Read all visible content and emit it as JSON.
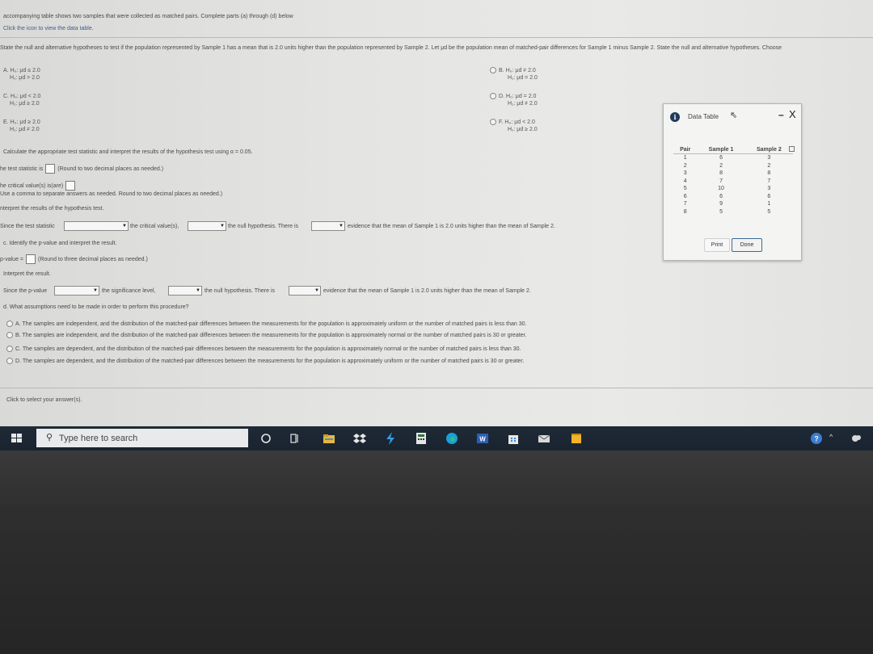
{
  "header": {
    "line1": "accompanying table shows two samples that were collected as matched pairs. Complete parts (a) through (d) below",
    "line2": "Click the icon to view the data table."
  },
  "part_a": {
    "prompt": "State the null and alternative hypotheses to test if the population represented by Sample 1 has a mean that is 2.0 units higher than the population represented by Sample 2. Let μd be the population mean of matched-pair differences for Sample 1 minus Sample 2. State the null and alternative hypotheses. Choose",
    "options": [
      {
        "letter": "A.",
        "h0": "H₀: μd ≤ 2.0",
        "h1": "H₁: μd > 2.0"
      },
      {
        "letter": "B.",
        "h0": "H₀: μd ≠ 2.0",
        "h1": "H₁: μd = 2.0"
      },
      {
        "letter": "C.",
        "h0": "H₀: μd < 2.0",
        "h1": "H₁: μd ≥ 2.0"
      },
      {
        "letter": "D.",
        "h0": "H₀: μd = 2.0",
        "h1": "H₁: μd ≠ 2.0"
      },
      {
        "letter": "E.",
        "h0": "H₀: μd ≥ 2.0",
        "h1": "H₁: μd ≠ 2.0"
      },
      {
        "letter": "F.",
        "h0": "H₀: μd < 2.0",
        "h1": "H₁: μd ≥ 2.0"
      }
    ]
  },
  "part_b": {
    "prompt": "Calculate the appropriate test statistic and interpret the results of the hypothesis test using α = 0.05.",
    "stat_pre": "he test statistic is",
    "stat_post": "(Round to two decimal places as needed.)",
    "crit_pre": "he critical value(s) is(are)",
    "crit_note": "Use a comma to separate answers as needed. Round to two decimal places as needed.)",
    "interp_label": "nterpret the results of the hypothesis test.",
    "since": "Since the test statistic",
    "mid1": "the critical value(s),",
    "mid2": "the null hypothesis. There is",
    "end": "evidence that the mean of Sample 1 is 2.0 units higher than the mean of Sample 2."
  },
  "part_c": {
    "prompt": "c. Identify the p-value and interpret the result.",
    "pval_pre": "p-value =",
    "pval_post": "(Round to three decimal places as needed.)",
    "interp_label": "Interpret the result.",
    "since": "Since the p-value",
    "mid1": "the significance level,",
    "mid2": "the null hypothesis. There is",
    "end": "evidence that the mean of Sample 1 is 2.0 units higher than the mean of Sample 2."
  },
  "part_d": {
    "prompt": "d. What assumptions need to be made in order to perform this procedure?",
    "options": [
      "A.  The samples are independent, and the distribution of the matched-pair differences between the measurements for the population is approximately uniform or the number of matched pairs is less than 30.",
      "B.  The samples are independent, and the distribution of the matched-pair differences between the measurements for the population is approximately normal or the number of matched pairs is 30 or greater.",
      "C.  The samples are dependent, and the distribution of the matched-pair differences between the measurements for the population is approximately normal or the number of matched pairs is less than 30.",
      "D.  The samples are dependent, and the distribution of the matched-pair differences between the measurements for the population is approximately uniform or the number of matched pairs is 30 or greater."
    ]
  },
  "footer": {
    "click_text": "Click to select your answer(s)."
  },
  "popup": {
    "title": "Data Table",
    "columns": [
      "Pair",
      "Sample 1",
      "Sample 2"
    ],
    "rows": [
      [
        "1",
        "6",
        "3"
      ],
      [
        "2",
        "2",
        "2"
      ],
      [
        "3",
        "8",
        "8"
      ],
      [
        "4",
        "7",
        "7"
      ],
      [
        "5",
        "10",
        "3"
      ],
      [
        "6",
        "6",
        "6"
      ],
      [
        "7",
        "9",
        "1"
      ],
      [
        "8",
        "5",
        "5"
      ]
    ],
    "print_label": "Print",
    "done_label": "Done",
    "close_glyph": "X",
    "min_glyph": "–"
  },
  "taskbar": {
    "search_placeholder": "Type here to search"
  },
  "colors": {
    "screen_bg": "#e4e4e2",
    "taskbar": "#1e2a36",
    "done_border": "#3c6a9a"
  }
}
